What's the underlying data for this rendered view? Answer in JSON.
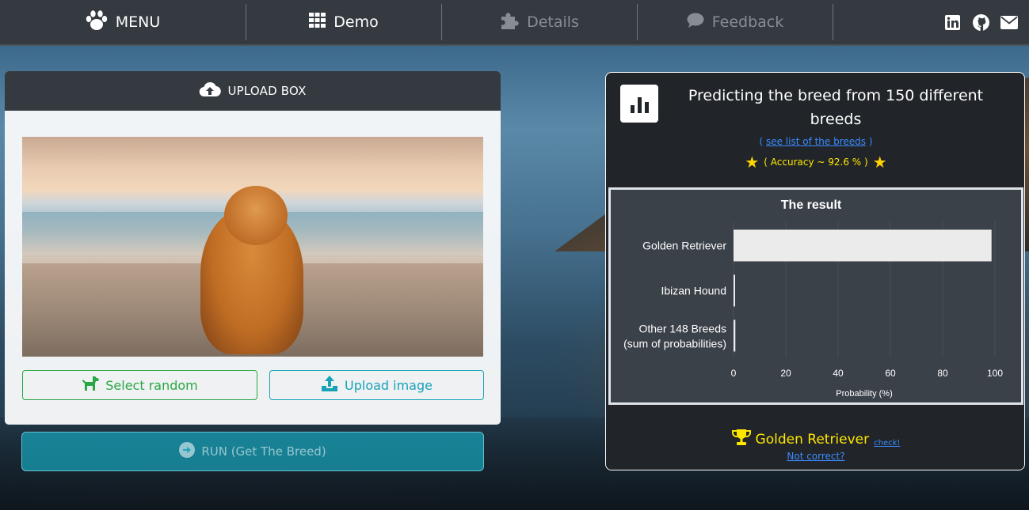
{
  "navbar": {
    "brand_label": "MENU",
    "brand_icon": "paw-icon",
    "links": [
      {
        "label": "Demo",
        "icon": "grid-icon",
        "state": "active"
      },
      {
        "label": "Details",
        "icon": "puzzle-icon",
        "state": "muted"
      },
      {
        "label": "Feedback",
        "icon": "comment-icon",
        "state": "muted"
      }
    ],
    "social": [
      "linkedin-icon",
      "github-icon",
      "envelope-icon"
    ]
  },
  "upload": {
    "header": "UPLOAD BOX",
    "select_random": "Select random",
    "upload_image": "Upload image",
    "run": "RUN (Get The Breed)"
  },
  "result": {
    "title": "Predicting the breed from 150 different breeds",
    "see_list": "( see list of the breeds )",
    "see_list_link": "see list of the breeds",
    "accuracy": "( Accuracy ~ 92.6 % )",
    "winner": "Golden Retriever",
    "check": "check!",
    "not_correct": "Not correct?"
  },
  "colors": {
    "navbar": "#343a40",
    "green": "#28a745",
    "teal": "#17a2b8",
    "link": "#3b8bff",
    "gold": "#ffe600"
  },
  "chart_data": {
    "type": "bar",
    "orientation": "horizontal",
    "title": "The result",
    "xlabel": "Probability (%)",
    "ylabel": "",
    "xlim": [
      0,
      100
    ],
    "xticks": [
      0,
      20,
      40,
      60,
      80,
      100
    ],
    "categories": [
      "Golden Retriever",
      "Ibizan Hound",
      "Other 148 Breeds\n(sum of probabilities)"
    ],
    "values": [
      98.7,
      0.6,
      0.7
    ]
  }
}
